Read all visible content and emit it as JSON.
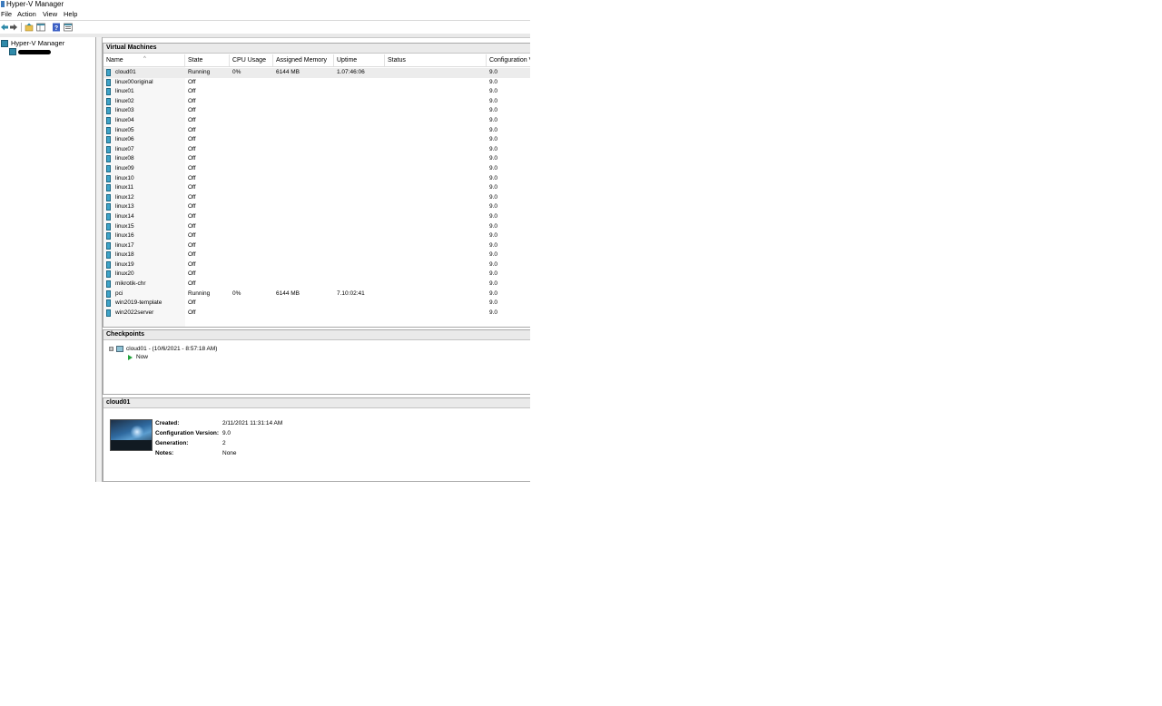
{
  "window": {
    "title": "Hyper-V Manager"
  },
  "menu": [
    "File",
    "Action",
    "View",
    "Help"
  ],
  "toolbar": {
    "icons": [
      "back-arrow-icon",
      "forward-arrow-icon",
      "up-folder-icon",
      "show-hide-tree-icon",
      "help-icon",
      "properties-icon"
    ],
    "accent": "#2f8aa9"
  },
  "tree": {
    "root_label": "Hyper-V Manager"
  },
  "vm_panel": {
    "title": "Virtual Machines",
    "columns": [
      "Name",
      "State",
      "CPU Usage",
      "Assigned Memory",
      "Uptime",
      "Status",
      "Configuration V"
    ],
    "rows": [
      {
        "name": "cloud01",
        "state": "Running",
        "cpu": "0%",
        "memory": "6144 MB",
        "uptime": "1.07:46:06",
        "status": "",
        "config": "9.0",
        "selected": true
      },
      {
        "name": "linux00original",
        "state": "Off",
        "cpu": "",
        "memory": "",
        "uptime": "",
        "status": "",
        "config": "9.0"
      },
      {
        "name": "linux01",
        "state": "Off",
        "cpu": "",
        "memory": "",
        "uptime": "",
        "status": "",
        "config": "9.0"
      },
      {
        "name": "linux02",
        "state": "Off",
        "cpu": "",
        "memory": "",
        "uptime": "",
        "status": "",
        "config": "9.0"
      },
      {
        "name": "linux03",
        "state": "Off",
        "cpu": "",
        "memory": "",
        "uptime": "",
        "status": "",
        "config": "9.0"
      },
      {
        "name": "linux04",
        "state": "Off",
        "cpu": "",
        "memory": "",
        "uptime": "",
        "status": "",
        "config": "9.0"
      },
      {
        "name": "linux05",
        "state": "Off",
        "cpu": "",
        "memory": "",
        "uptime": "",
        "status": "",
        "config": "9.0"
      },
      {
        "name": "linux06",
        "state": "Off",
        "cpu": "",
        "memory": "",
        "uptime": "",
        "status": "",
        "config": "9.0"
      },
      {
        "name": "linux07",
        "state": "Off",
        "cpu": "",
        "memory": "",
        "uptime": "",
        "status": "",
        "config": "9.0"
      },
      {
        "name": "linux08",
        "state": "Off",
        "cpu": "",
        "memory": "",
        "uptime": "",
        "status": "",
        "config": "9.0"
      },
      {
        "name": "linux09",
        "state": "Off",
        "cpu": "",
        "memory": "",
        "uptime": "",
        "status": "",
        "config": "9.0"
      },
      {
        "name": "linux10",
        "state": "Off",
        "cpu": "",
        "memory": "",
        "uptime": "",
        "status": "",
        "config": "9.0"
      },
      {
        "name": "linux11",
        "state": "Off",
        "cpu": "",
        "memory": "",
        "uptime": "",
        "status": "",
        "config": "9.0"
      },
      {
        "name": "linux12",
        "state": "Off",
        "cpu": "",
        "memory": "",
        "uptime": "",
        "status": "",
        "config": "9.0"
      },
      {
        "name": "linux13",
        "state": "Off",
        "cpu": "",
        "memory": "",
        "uptime": "",
        "status": "",
        "config": "9.0"
      },
      {
        "name": "linux14",
        "state": "Off",
        "cpu": "",
        "memory": "",
        "uptime": "",
        "status": "",
        "config": "9.0"
      },
      {
        "name": "linux15",
        "state": "Off",
        "cpu": "",
        "memory": "",
        "uptime": "",
        "status": "",
        "config": "9.0"
      },
      {
        "name": "linux16",
        "state": "Off",
        "cpu": "",
        "memory": "",
        "uptime": "",
        "status": "",
        "config": "9.0"
      },
      {
        "name": "linux17",
        "state": "Off",
        "cpu": "",
        "memory": "",
        "uptime": "",
        "status": "",
        "config": "9.0"
      },
      {
        "name": "linux18",
        "state": "Off",
        "cpu": "",
        "memory": "",
        "uptime": "",
        "status": "",
        "config": "9.0"
      },
      {
        "name": "linux19",
        "state": "Off",
        "cpu": "",
        "memory": "",
        "uptime": "",
        "status": "",
        "config": "9.0"
      },
      {
        "name": "linux20",
        "state": "Off",
        "cpu": "",
        "memory": "",
        "uptime": "",
        "status": "",
        "config": "9.0"
      },
      {
        "name": "mikrotik-chr",
        "state": "Off",
        "cpu": "",
        "memory": "",
        "uptime": "",
        "status": "",
        "config": "9.0"
      },
      {
        "name": "pci",
        "state": "Running",
        "cpu": "0%",
        "memory": "6144 MB",
        "uptime": "7.10:02:41",
        "status": "",
        "config": "9.0"
      },
      {
        "name": "win2019-template",
        "state": "Off",
        "cpu": "",
        "memory": "",
        "uptime": "",
        "status": "",
        "config": "9.0"
      },
      {
        "name": "win2022server",
        "state": "Off",
        "cpu": "",
        "memory": "",
        "uptime": "",
        "status": "",
        "config": "9.0"
      }
    ]
  },
  "checkpoints": {
    "title": "Checkpoints",
    "expander": "⊟",
    "items": [
      {
        "label": "cloud01 - (10/6/2021 - 8:57:18 AM)"
      },
      {
        "label": "Now"
      }
    ]
  },
  "details": {
    "title": "cloud01",
    "fields": [
      {
        "label": "Created:",
        "value": "2/11/2021 11:31:14 AM"
      },
      {
        "label": "Configuration Version:",
        "value": "9.0"
      },
      {
        "label": "Generation:",
        "value": "2"
      },
      {
        "label": "Notes:",
        "value": "None"
      }
    ]
  }
}
